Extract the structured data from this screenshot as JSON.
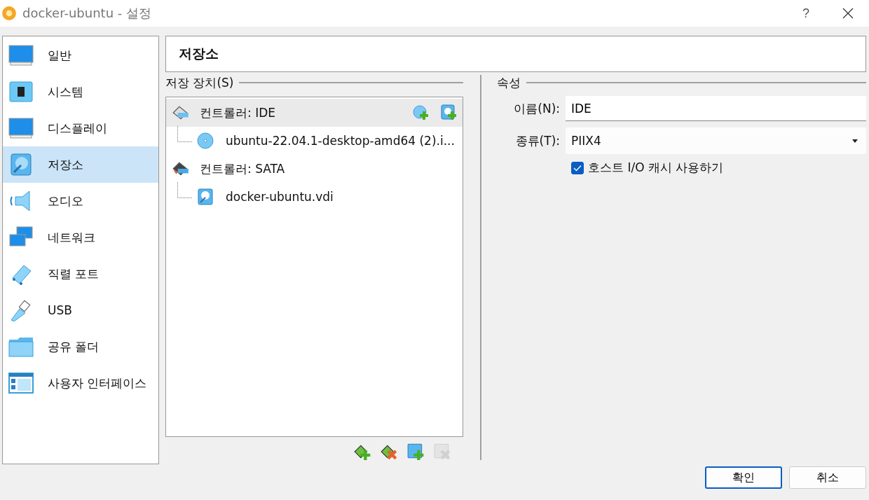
{
  "window": {
    "title": "docker-ubuntu - 설정",
    "help": "?"
  },
  "sidebar": {
    "items": [
      {
        "label": "일반",
        "selected": false
      },
      {
        "label": "시스템",
        "selected": false
      },
      {
        "label": "디스플레이",
        "selected": false
      },
      {
        "label": "저장소",
        "selected": true
      },
      {
        "label": "오디오",
        "selected": false
      },
      {
        "label": "네트워크",
        "selected": false
      },
      {
        "label": "직렬 포트",
        "selected": false
      },
      {
        "label": "USB",
        "selected": false
      },
      {
        "label": "공유 폴더",
        "selected": false
      },
      {
        "label": "사용자 인터페이스",
        "selected": false
      }
    ]
  },
  "page_title": "저장소",
  "storage": {
    "title": "저장 장치(S)",
    "tree": [
      {
        "label": "컨트롤러: IDE",
        "kind": "ide",
        "selected": true,
        "children": [
          {
            "label": "ubuntu-22.04.1-desktop-amd64 (2).i...",
            "kind": "optical",
            "selected": false
          }
        ]
      },
      {
        "label": "컨트롤러: SATA",
        "kind": "sata",
        "selected": false,
        "children": [
          {
            "label": "docker-ubuntu.vdi",
            "kind": "disk",
            "selected": false
          }
        ]
      }
    ],
    "toolbar": [
      {
        "kind": "add-controller",
        "disabled": false
      },
      {
        "kind": "remove-controller",
        "disabled": false
      },
      {
        "kind": "add-attachment",
        "disabled": false
      },
      {
        "kind": "remove-attachment",
        "disabled": true
      }
    ]
  },
  "properties": {
    "title": "속성",
    "name_label": "이름(N):",
    "name_value": "IDE",
    "type_label": "종류(T):",
    "type_value": "PIIX4",
    "cache": {
      "label": "호스트 I/O 캐시 사용하기",
      "checked": true
    }
  },
  "buttons": [
    "확인",
    "취소"
  ]
}
